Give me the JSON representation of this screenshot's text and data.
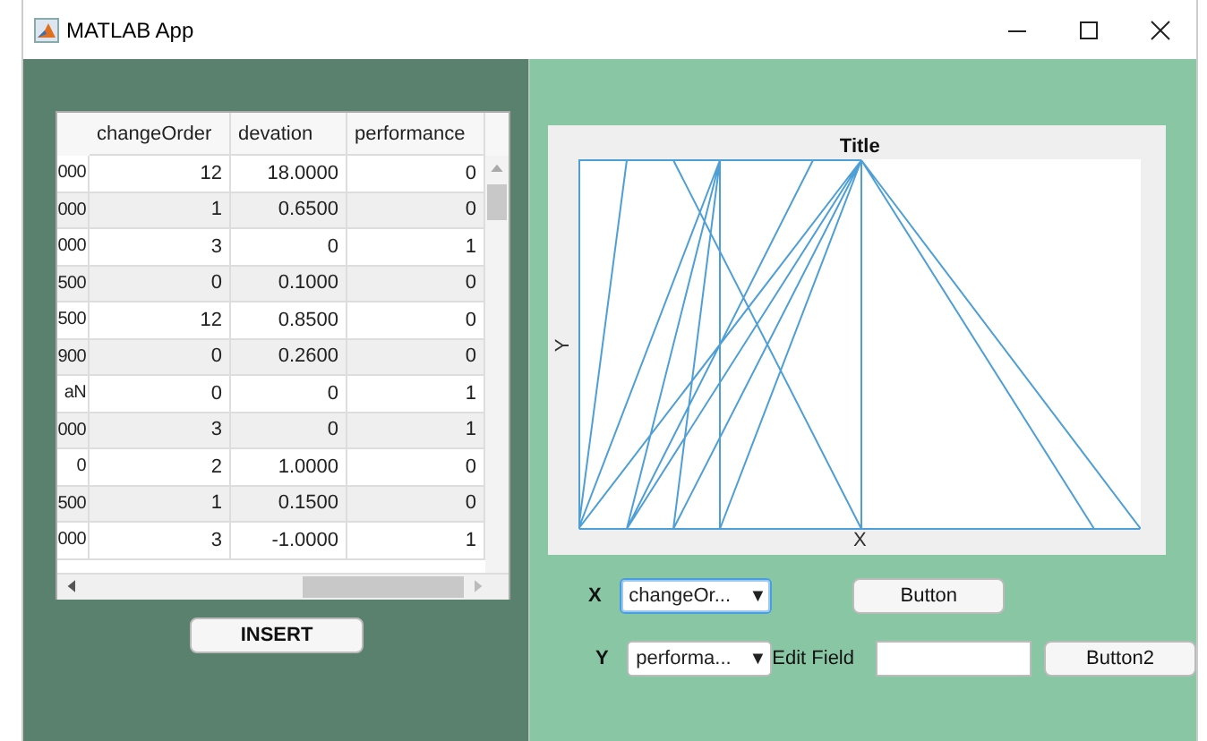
{
  "window": {
    "title": "MATLAB App"
  },
  "table": {
    "columns": [
      "changeOrder",
      "devation",
      "performance"
    ],
    "rows": [
      [
        "000",
        "12",
        "18.0000",
        "0"
      ],
      [
        "000",
        "1",
        "0.6500",
        "0"
      ],
      [
        "000",
        "3",
        "0",
        "1"
      ],
      [
        "500",
        "0",
        "0.1000",
        "0"
      ],
      [
        "500",
        "12",
        "0.8500",
        "0"
      ],
      [
        "900",
        "0",
        "0.2600",
        "0"
      ],
      [
        "aN",
        "0",
        "0",
        "1"
      ],
      [
        "000",
        "3",
        "0",
        "1"
      ],
      [
        "0",
        "2",
        "1.0000",
        "0"
      ],
      [
        "500",
        "1",
        "0.1500",
        "0"
      ],
      [
        "000",
        "3",
        "-1.0000",
        "1"
      ]
    ]
  },
  "insert_button": "INSERT",
  "plot": {
    "title": "Title",
    "xlabel": "X",
    "ylabel": "Y"
  },
  "x_selector": {
    "label": "X",
    "value": "changeOr...",
    "arrow": "▼",
    "focused": true
  },
  "button": "Button",
  "y_selector": {
    "label": "Y",
    "value": "performa...",
    "arrow": "▼",
    "focused": false
  },
  "edit_field": {
    "label": "Edit Field"
  },
  "button2": "Button2"
}
